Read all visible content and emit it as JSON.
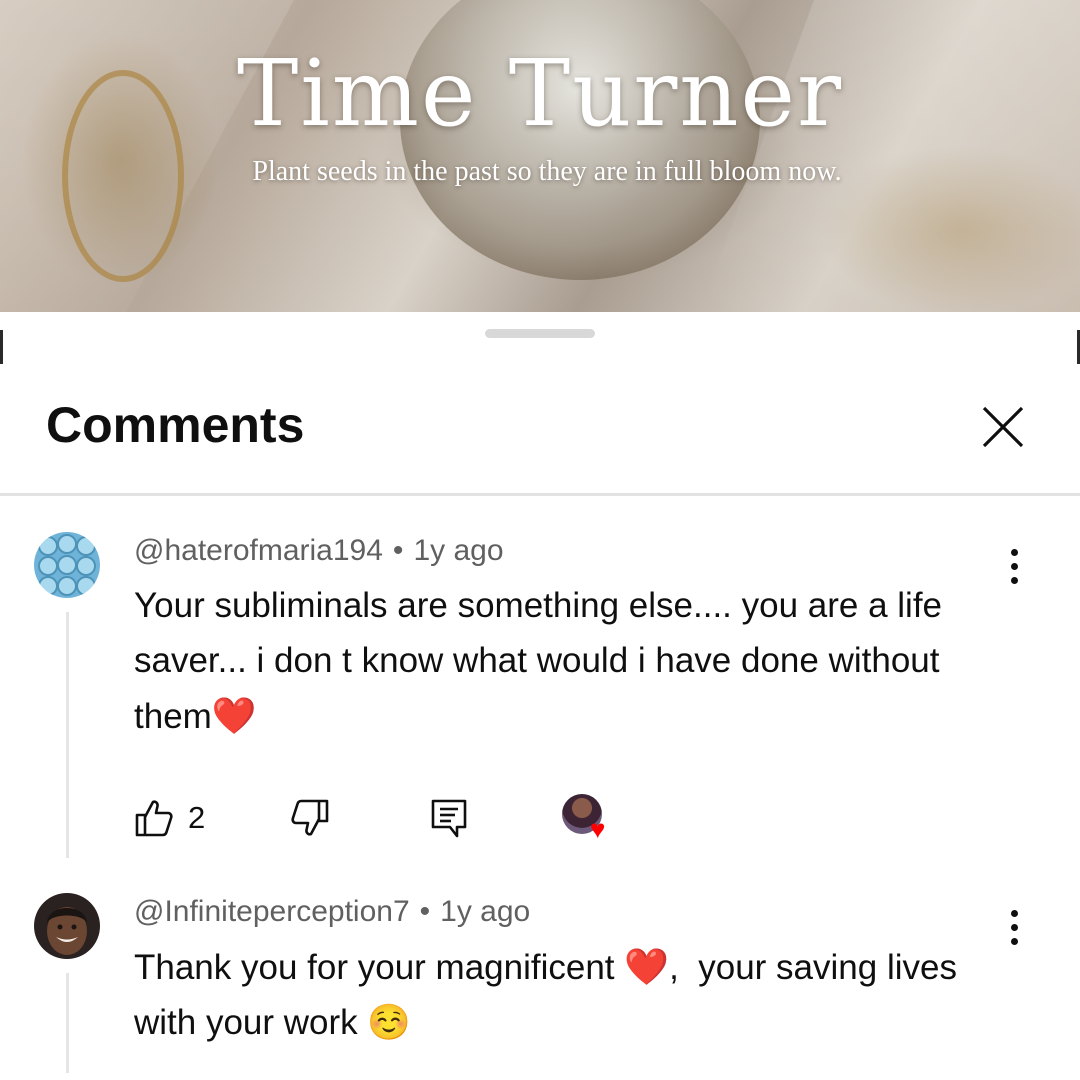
{
  "video": {
    "title": "Time Turner",
    "subtitle": "Plant seeds in the past so they are in full bloom now."
  },
  "panel": {
    "title": "Comments"
  },
  "comments": [
    {
      "author": "@haterofmaria194",
      "age": "1y ago",
      "text": "Your subliminals are something else.... you are a life saver... i don t know what would i have done without them",
      "emoji": "❤️",
      "likes": "2",
      "creator_heart": true
    },
    {
      "author": "@Infiniteperception7",
      "age": "1y ago",
      "text_before": "Thank you for your magnificent ",
      "emoji1": "❤️",
      "text_after": ",  your saving lives with your work ",
      "emoji2": "☺️"
    }
  ],
  "icons": {
    "like": "thumbs-up-icon",
    "dislike": "thumbs-down-icon",
    "reply": "reply-comment-icon",
    "more": "more-vertical-icon",
    "close": "close-icon"
  },
  "colors": {
    "heart": "#ff0000",
    "meta_text": "#606060",
    "divider": "#e2e2e2"
  }
}
